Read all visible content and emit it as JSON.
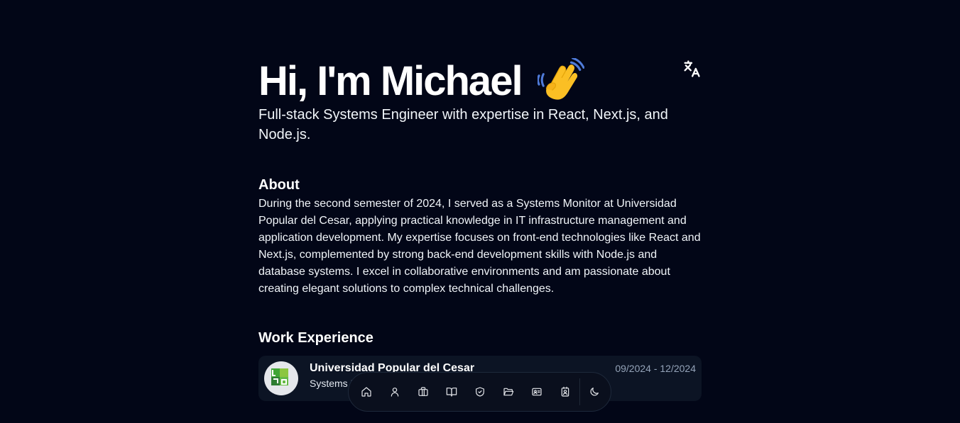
{
  "hero": {
    "greeting": "Hi, I'm Michael",
    "wave_icon": "waving-hand-emoji",
    "subtitle": "Full-stack Systems Engineer with expertise in React, Next.js, and Node.js."
  },
  "header": {
    "translate_icon": "translate-icon"
  },
  "about": {
    "title": "About",
    "text": "During the second semester of 2024, I served as a Systems Monitor at Universidad Popular del Cesar, applying practical knowledge in IT infrastructure management and application development. My expertise focuses on front-end technologies like React and Next.js, complemented by strong back-end development skills with Node.js and database systems. I excel in collaborative environments and am passionate about creating elegant solutions to complex technical challenges."
  },
  "work": {
    "title": "Work Experience",
    "items": [
      {
        "company": "Universidad Popular del Cesar",
        "role": "Systems M",
        "dates": "09/2024 - 12/2024"
      }
    ]
  },
  "dock": {
    "items": [
      "home-icon",
      "user-icon",
      "briefcase-icon",
      "book-open-icon",
      "shield-check-icon",
      "folder-open-icon",
      "id-card-icon",
      "contact-badge-icon",
      "moon-icon"
    ]
  },
  "colors": {
    "background": "#020617",
    "card": "#0c1424",
    "text": "#f8fafc",
    "muted": "#94a3b8"
  }
}
